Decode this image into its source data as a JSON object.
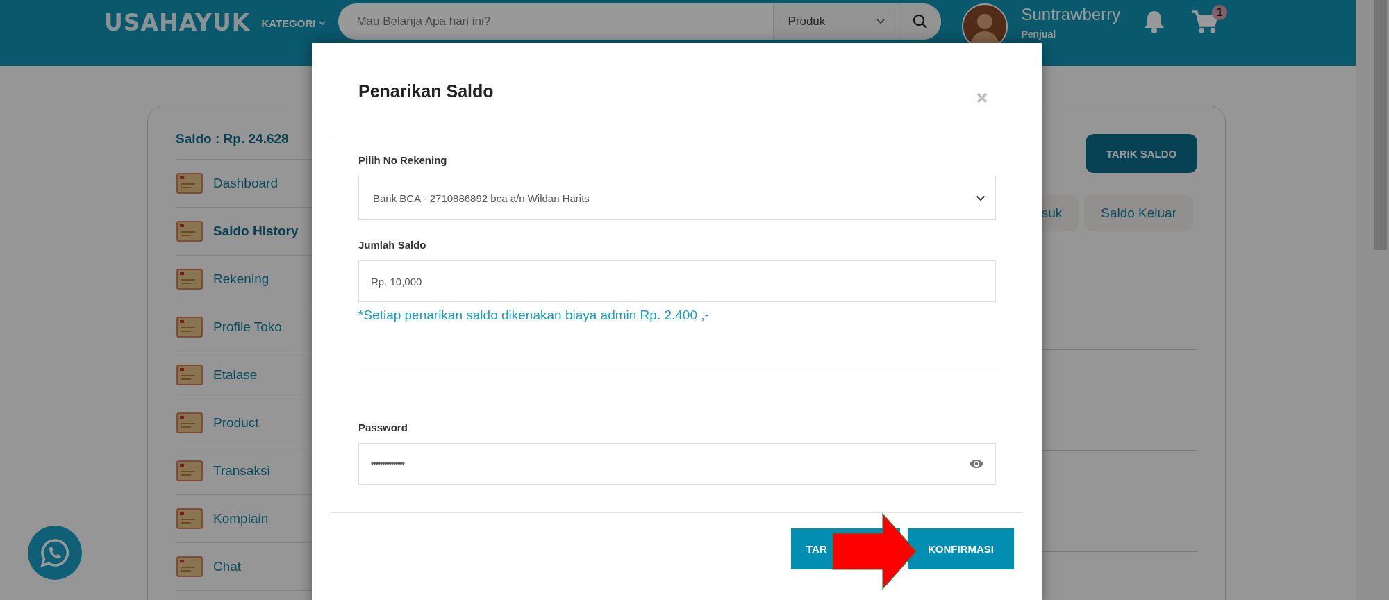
{
  "header": {
    "logo": "USAHAYUK",
    "category_menu": "KATEGORI",
    "search": {
      "placeholder": "Mau Belanja Apa hari ini?",
      "scope": "Produk"
    },
    "user": {
      "name": "Suntrawberry",
      "role": "Penjual"
    },
    "cart_count": "1"
  },
  "sidebar": {
    "balance": "Saldo : Rp. 24.628",
    "items": [
      {
        "label": "Dashboard",
        "selected": false
      },
      {
        "label": "Saldo History",
        "selected": true
      },
      {
        "label": "Rekening",
        "selected": false
      },
      {
        "label": "Profile Toko",
        "selected": false
      },
      {
        "label": "Etalase",
        "selected": false
      },
      {
        "label": "Product",
        "selected": false
      },
      {
        "label": "Transaksi",
        "selected": false
      },
      {
        "label": "Komplain",
        "selected": false
      },
      {
        "label": "Chat",
        "selected": false
      }
    ]
  },
  "main": {
    "withdraw_button": "TARIK SALDO",
    "tabs": [
      {
        "label": "suk",
        "selected": false
      },
      {
        "label": "Saldo Keluar",
        "selected": false
      }
    ]
  },
  "modal": {
    "title": "Penarikan Saldo",
    "fields": [
      {
        "kind": "select",
        "label": "Pilih No Rekening",
        "value": "Bank BCA - 2710886892 bca a/n Wildan Harits"
      },
      {
        "kind": "text",
        "label": "Jumlah Saldo",
        "value": "Rp. 10,000",
        "note": "*Setiap penarikan saldo dikenakan biaya admin Rp. 2.400 ,-"
      },
      {
        "kind": "password",
        "label": "Password",
        "value": "•••••••••••••••"
      }
    ],
    "buttons": [
      "TAR",
      "KONFIRMASI"
    ]
  }
}
